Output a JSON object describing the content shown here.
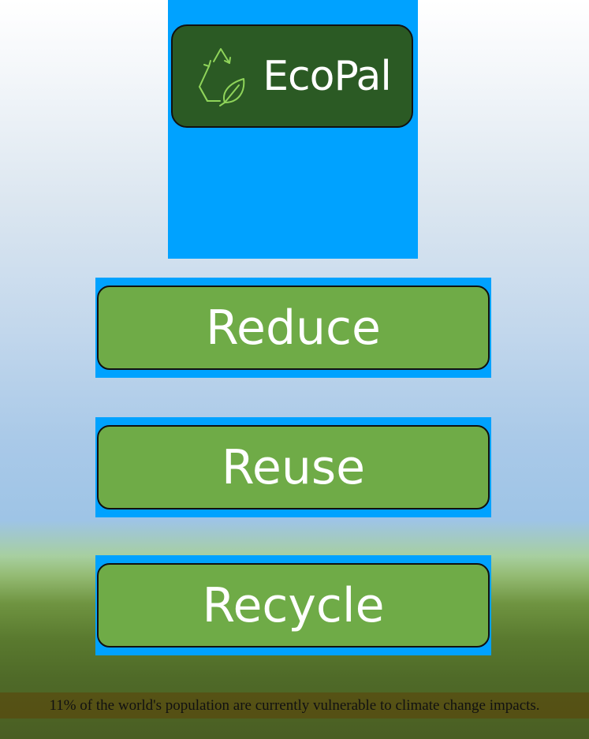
{
  "app": {
    "logo_text": "EcoPal",
    "logo_icon": "recycle-leaf-icon"
  },
  "buttons": [
    {
      "label": "Reduce"
    },
    {
      "label": "Reuse"
    },
    {
      "label": "Recycle"
    }
  ],
  "fact": {
    "text": "11% of the world's population are currently vulnerable to climate change impacts."
  },
  "colors": {
    "panel_blue": "#00a2ff",
    "logo_green": "#2b5a24",
    "button_green": "#6fab47",
    "icon_green": "#8fd45a"
  }
}
